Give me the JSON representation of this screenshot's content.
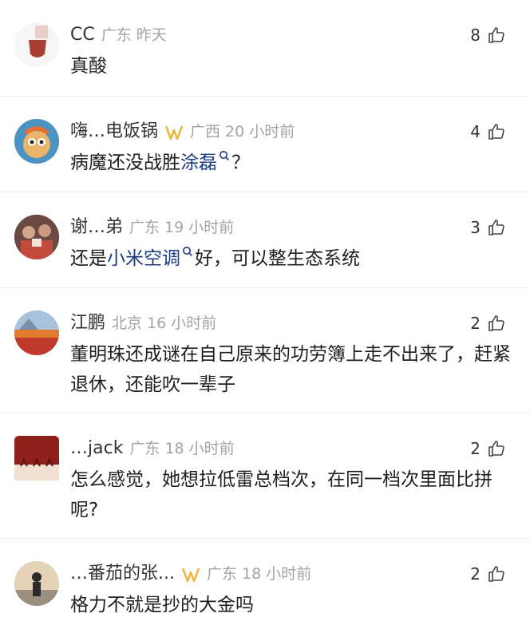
{
  "comments": [
    {
      "name": "CC",
      "region": "广东",
      "time": "昨天",
      "likes": "8",
      "text": "真酸",
      "badge": false
    },
    {
      "name": "嗨…电饭锅",
      "region": "广西",
      "time": "20 小时前",
      "likes": "4",
      "text_before": "病魔还没战胜",
      "topic": "涂磊",
      "text_after": "？",
      "badge": true
    },
    {
      "name": "谢…弟",
      "region": "广东",
      "time": "19 小时前",
      "likes": "3",
      "text_before": "还是",
      "topic": "小米空调",
      "text_after": "好，可以整生态系统",
      "badge": false
    },
    {
      "name": "江鹏",
      "region": "北京",
      "time": "16 小时前",
      "likes": "2",
      "text": "董明珠还成谜在自己原来的功劳簿上走不出来了，赶紧退休，还能吹一辈子",
      "badge": false
    },
    {
      "name": "…jack",
      "region": "广东",
      "time": "18 小时前",
      "likes": "2",
      "text": "怎么感觉，她想拉低雷总档次，在同一档次里面比拼呢?",
      "badge": false
    },
    {
      "name": "…番茄的张...",
      "region": "广东",
      "time": "18 小时前",
      "likes": "2",
      "text": "格力不就是抄的大金吗",
      "badge": true
    }
  ],
  "colors": {
    "topic": "#1c3c85",
    "meta": "#a3a3a3",
    "badge": "#f0b43a"
  }
}
